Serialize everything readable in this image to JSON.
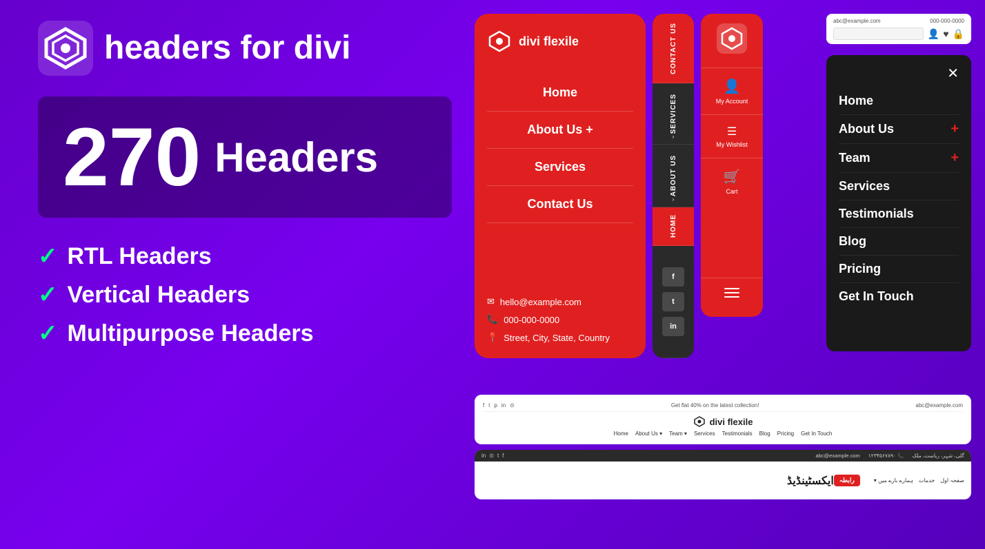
{
  "logo": {
    "text": "headers for divi",
    "icon_alt": "divi-logo"
  },
  "counter": {
    "number": "270",
    "label": "Headers"
  },
  "features": [
    {
      "id": "rtl",
      "text": "RTL Headers"
    },
    {
      "id": "vertical",
      "text": "Vertical Headers"
    },
    {
      "id": "multipurpose",
      "text": "Multipurpose Headers"
    }
  ],
  "panel_red_mobile": {
    "logo_text": "divi flexile",
    "nav_items": [
      "Home",
      "About Us +",
      "Services",
      "Contact Us"
    ],
    "email": "hello@example.com",
    "phone": "000-000-0000",
    "address": "Street, City, State, Country"
  },
  "panel_vertical": {
    "sections": [
      "Contact Us",
      "Services",
      "About Us",
      "Home"
    ],
    "socials": [
      "f",
      "t",
      "in"
    ]
  },
  "panel_icon": {
    "menu_items": [
      {
        "icon": "👤",
        "label": "My Account"
      },
      {
        "icon": "≡",
        "label": "My Wishlist"
      },
      {
        "icon": "🛒",
        "label": "Cart"
      }
    ]
  },
  "panel_dark_modal": {
    "nav_items": [
      {
        "label": "Home",
        "has_plus": false
      },
      {
        "label": "About Us",
        "has_plus": true
      },
      {
        "label": "Team",
        "has_plus": true
      },
      {
        "label": "Services",
        "has_plus": false
      },
      {
        "label": "Testimonials",
        "has_plus": false
      },
      {
        "label": "Blog",
        "has_plus": false
      },
      {
        "label": "Pricing",
        "has_plus": false
      },
      {
        "label": "Get In Touch",
        "has_plus": false
      }
    ]
  },
  "panel_desktop_top": {
    "email": "abc@example.com",
    "phone": "000-000-0000"
  },
  "panel_bottom_light": {
    "logo_text": "divi flexile",
    "top_bar": "Get flat 40% on the latest collection!",
    "top_bar_right": "abc@example.com",
    "nav_items": [
      "Home",
      "About Us ▾",
      "Team ▾",
      "Services",
      "Testimonials",
      "Blog",
      "Pricing",
      "Get In Touch"
    ]
  },
  "panel_bottom_rtl": {
    "title": "ایکسٹینڈیڈ",
    "top_bar_left": "abc@example.com",
    "top_bar_phone": "۱۲۳۴۵۶۷۸۹۰",
    "top_bar_address": "گلی، شہر، ریاست، ملک",
    "nav_items": [
      "صفحہ اول",
      "خدمات",
      "ہمارے بارے میں ▾"
    ],
    "button": "رابطہ",
    "socials": [
      "in",
      "insta",
      "tw",
      "fb"
    ]
  },
  "colors": {
    "bg_purple": "#7700ee",
    "red": "#e02020",
    "dark": "#1a1a1a",
    "check_green": "#00ff88"
  }
}
